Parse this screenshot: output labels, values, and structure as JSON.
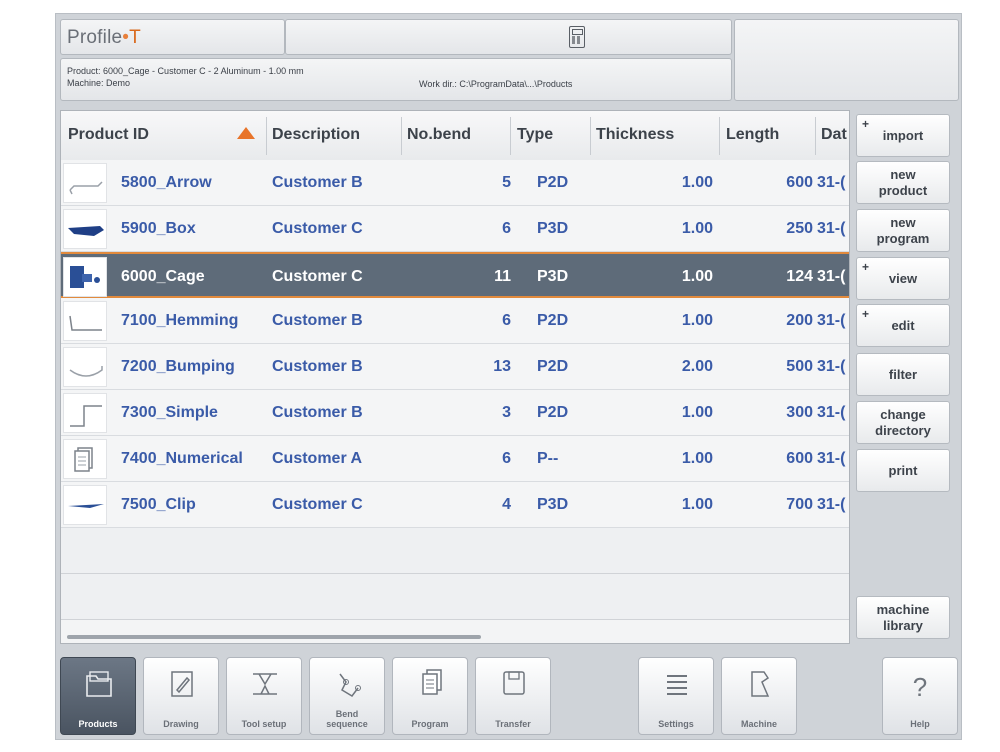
{
  "header": {
    "brand_name": "Profile",
    "brand_dot": "•",
    "brand_suffix": "T",
    "product_line": "Product: 6000_Cage - Customer C - 2 Aluminum - 1.00 mm",
    "machine_line": "Machine: Demo",
    "work_dir": "Work dir.: C:\\ProgramData\\...\\Products"
  },
  "table": {
    "columns": [
      "Product ID",
      "Description",
      "No.bend",
      "Type",
      "Thickness",
      "Length",
      "Dat"
    ],
    "rows": [
      {
        "id": "5800_Arrow",
        "description": "Customer B",
        "bends": "5",
        "type": "P2D",
        "thickness": "1.00",
        "length": "600",
        "date": "31-(",
        "icon": "arrow-profile-icon"
      },
      {
        "id": "5900_Box",
        "description": "Customer C",
        "bends": "6",
        "type": "P3D",
        "thickness": "1.00",
        "length": "250",
        "date": "31-(",
        "icon": "box-profile-icon"
      },
      {
        "id": "6000_Cage",
        "description": "Customer C",
        "bends": "11",
        "type": "P3D",
        "thickness": "1.00",
        "length": "124",
        "date": "31-(",
        "icon": "cage-profile-icon",
        "selected": true
      },
      {
        "id": "7100_Hemming",
        "description": "Customer B",
        "bends": "6",
        "type": "P2D",
        "thickness": "1.00",
        "length": "200",
        "date": "31-(",
        "icon": "hemming-profile-icon"
      },
      {
        "id": "7200_Bumping",
        "description": "Customer B",
        "bends": "13",
        "type": "P2D",
        "thickness": "2.00",
        "length": "500",
        "date": "31-(",
        "icon": "bumping-profile-icon"
      },
      {
        "id": "7300_Simple",
        "description": "Customer B",
        "bends": "3",
        "type": "P2D",
        "thickness": "1.00",
        "length": "300",
        "date": "31-(",
        "icon": "simple-profile-icon"
      },
      {
        "id": "7400_Numerical",
        "description": "Customer A",
        "bends": "6",
        "type": "P--",
        "thickness": "1.00",
        "length": "600",
        "date": "31-(",
        "icon": "numerical-document-icon"
      },
      {
        "id": "7500_Clip",
        "description": "Customer C",
        "bends": "4",
        "type": "P3D",
        "thickness": "1.00",
        "length": "700",
        "date": "31-(",
        "icon": "clip-profile-icon"
      }
    ]
  },
  "side_buttons": [
    {
      "label": "import",
      "plus": "+"
    },
    {
      "label": "new\nproduct",
      "plus": ""
    },
    {
      "label": "new\nprogram",
      "plus": ""
    },
    {
      "label": "view",
      "plus": "+"
    },
    {
      "label": "edit",
      "plus": "+"
    },
    {
      "label": "filter",
      "plus": ""
    },
    {
      "label": "change\ndirectory",
      "plus": ""
    },
    {
      "label": "print",
      "plus": ""
    }
  ],
  "machine_library_label": "machine\nlibrary",
  "toolbar": [
    {
      "label": "Products",
      "icon": "folder-icon",
      "active": true
    },
    {
      "label": "Drawing",
      "icon": "pencil-icon",
      "active": false
    },
    {
      "label": "Tool setup",
      "icon": "tool-setup-icon",
      "active": false
    },
    {
      "label": "Bend\nsequence",
      "icon": "bend-sequence-icon",
      "active": false
    },
    {
      "label": "Program",
      "icon": "program-pages-icon",
      "active": false
    },
    {
      "label": "Transfer",
      "icon": "floppy-disk-icon",
      "active": false
    },
    {
      "label": "Settings",
      "icon": "settings-list-icon",
      "active": false
    },
    {
      "label": "Machine",
      "icon": "machine-icon",
      "active": false
    },
    {
      "label": "Help",
      "icon": "question-icon",
      "glyph": "?",
      "active": false
    }
  ],
  "colors": {
    "accent": "#e8742a",
    "selected_row": "#5e6b79",
    "link_text": "#3a5ba8"
  }
}
